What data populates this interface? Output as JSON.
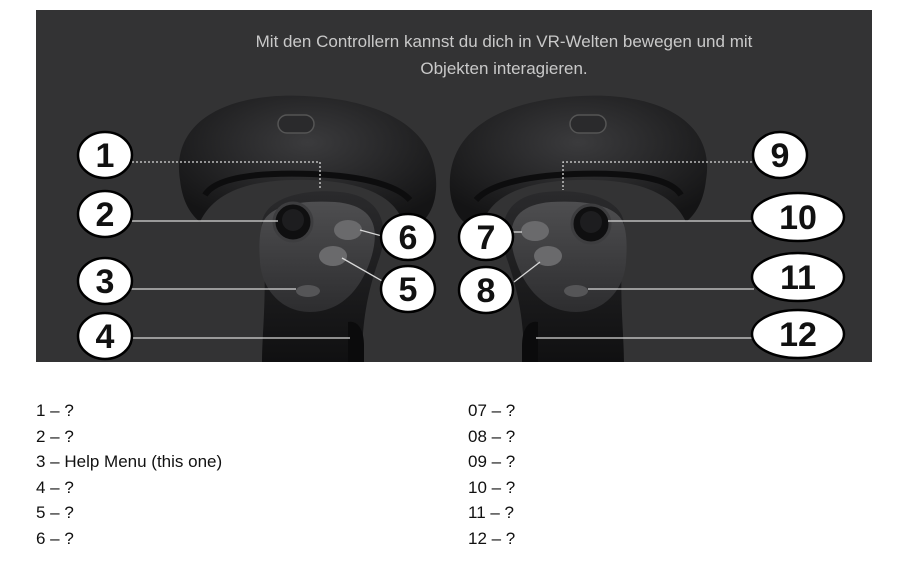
{
  "caption": {
    "line1": "Mit den Controllern kannst du dich in VR-Welten bewegen und mit",
    "line2": "Objekten interagieren."
  },
  "callouts": [
    {
      "number": "1"
    },
    {
      "number": "2"
    },
    {
      "number": "3"
    },
    {
      "number": "4"
    },
    {
      "number": "5"
    },
    {
      "number": "6"
    },
    {
      "number": "7"
    },
    {
      "number": "8"
    },
    {
      "number": "9"
    },
    {
      "number": "10"
    },
    {
      "number": "11"
    },
    {
      "number": "12"
    }
  ],
  "legend_left": [
    "1 – ?",
    "2 – ?",
    "3 – Help Menu (this one)",
    "4 – ?",
    "5 – ?",
    "6 – ?"
  ],
  "legend_right": [
    "07 – ?",
    "08 – ?",
    "09 – ?",
    "10 – ?",
    "11 – ?",
    "12 – ?"
  ],
  "colors": {
    "panel_background": "#333334",
    "controller_body": "#1a1a1b",
    "controller_highlight": "#4a4a4c",
    "button_face": "#5f5f61",
    "leader_line": "#d8d8d8",
    "callout_fill": "#ffffff",
    "callout_border": "#000000"
  }
}
